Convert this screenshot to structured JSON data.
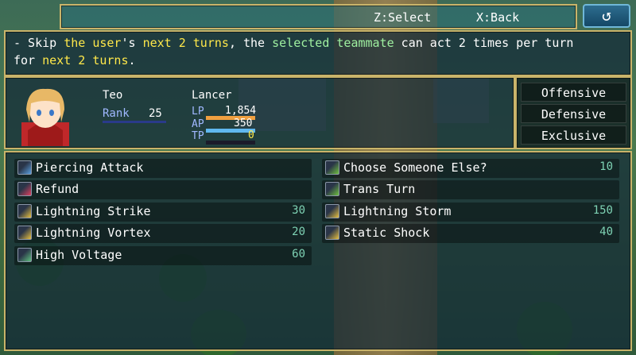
{
  "help": {
    "select": "Z:Select",
    "back": "X:Back",
    "back_icon": "↺"
  },
  "description": {
    "line1": [
      {
        "text": "- Skip ",
        "tone": "normal"
      },
      {
        "text": "the user",
        "tone": "yellow"
      },
      {
        "text": "'s ",
        "tone": "normal"
      },
      {
        "text": "next 2 turns",
        "tone": "yellow"
      },
      {
        "text": ", the ",
        "tone": "normal"
      },
      {
        "text": "selected teammate",
        "tone": "green"
      },
      {
        "text": " can act 2 times per turn",
        "tone": "normal"
      }
    ],
    "line2": [
      {
        "text": "for ",
        "tone": "normal"
      },
      {
        "text": "next 2 turns",
        "tone": "yellow"
      },
      {
        "text": ".",
        "tone": "normal"
      }
    ]
  },
  "actor": {
    "name": "Teo",
    "class": "Lancer",
    "rank_label": "Rank",
    "rank": "25",
    "lp_label": "LP",
    "lp": "1,854",
    "lp_fraction": 1.0,
    "ap_label": "AP",
    "ap": "350",
    "ap_fraction": 1.0,
    "tp_label": "TP",
    "tp": "0",
    "tp_fraction": 0.0
  },
  "categories": [
    "Offensive",
    "Defensive",
    "Exclusive"
  ],
  "skills_left": [
    {
      "name": "Piercing Attack",
      "cost": "",
      "icon": "spear-icon"
    },
    {
      "name": "Refund",
      "cost": "",
      "icon": "heart-icon"
    },
    {
      "name": "Lightning Strike",
      "cost": "30",
      "icon": "lightning-icon"
    },
    {
      "name": "Lightning Vortex",
      "cost": "20",
      "icon": "lightning-icon"
    },
    {
      "name": "High Voltage",
      "cost": "60",
      "icon": "voltage-icon"
    }
  ],
  "skills_right": [
    {
      "name": "Choose Someone Else?",
      "cost": "10",
      "icon": "boot-icon"
    },
    {
      "name": "Trans Turn",
      "cost": "",
      "icon": "boot-icon"
    },
    {
      "name": "Lightning Storm",
      "cost": "150",
      "icon": "lightning-icon"
    },
    {
      "name": "Static Shock",
      "cost": "40",
      "icon": "lightning-icon"
    }
  ],
  "colors": {
    "frame": "#c9b46a",
    "cost": "#7ed2b4",
    "lp_gauge": "#f0a040",
    "ap_gauge": "#60b8f0",
    "tp_gauge": "#40c060",
    "rank_label": "#a0b8ff"
  }
}
